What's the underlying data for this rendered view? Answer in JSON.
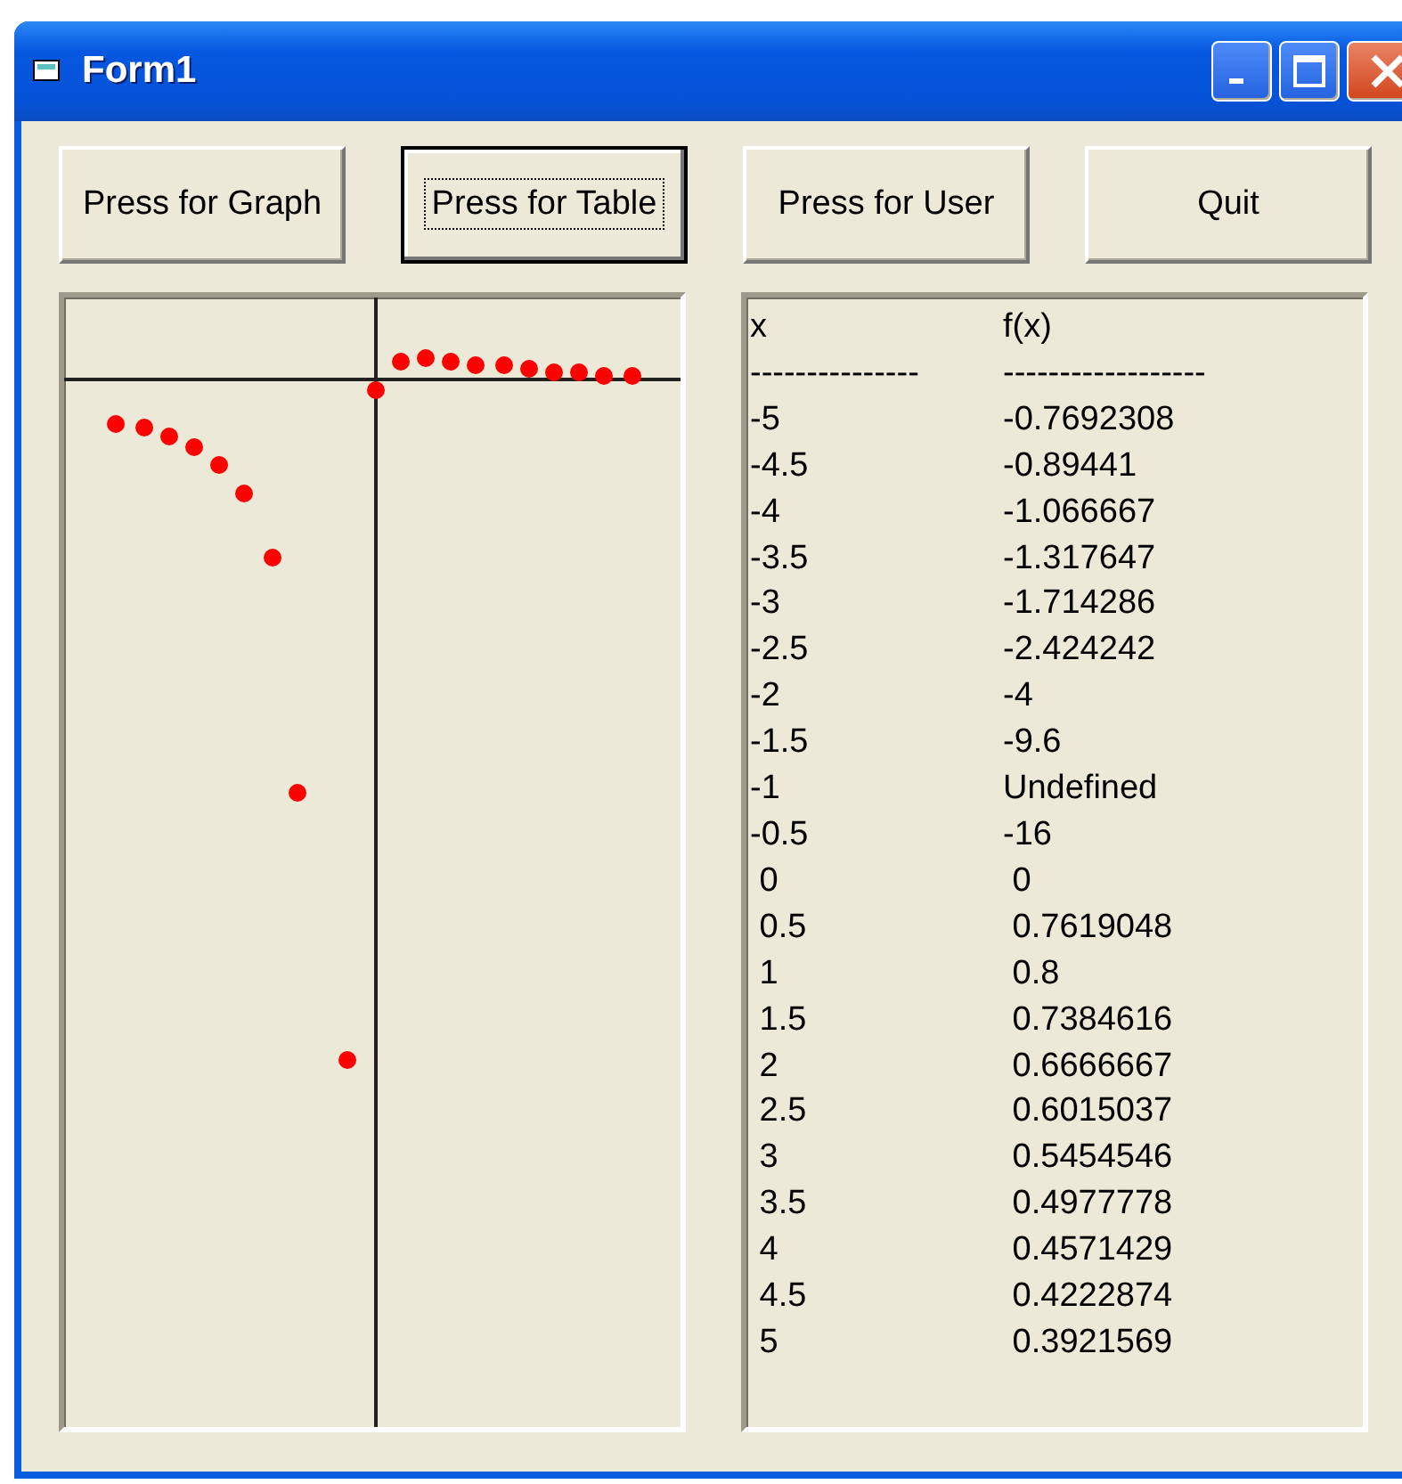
{
  "window": {
    "title": "Form1"
  },
  "buttons": [
    {
      "label": "Press for Graph",
      "focused": false
    },
    {
      "label": "Press for Table",
      "focused": true
    },
    {
      "label": "Press for User",
      "focused": false
    },
    {
      "label": "Quit",
      "focused": false
    }
  ],
  "table": {
    "columns": [
      "x",
      "f(x)"
    ],
    "separators": [
      "---------------",
      "------------------"
    ],
    "rows": [
      [
        "-5",
        "-0.7692308"
      ],
      [
        "-4.5",
        "-0.89441"
      ],
      [
        "-4",
        "-1.066667"
      ],
      [
        "-3.5",
        "-1.317647"
      ],
      [
        "-3",
        "-1.714286"
      ],
      [
        "-2.5",
        "-2.424242"
      ],
      [
        "-2",
        "-4"
      ],
      [
        "-1.5",
        "-9.6"
      ],
      [
        "-1",
        "Undefined"
      ],
      [
        "-0.5",
        "-16"
      ],
      [
        " 0",
        " 0"
      ],
      [
        " 0.5",
        " 0.7619048"
      ],
      [
        " 1",
        " 0.8"
      ],
      [
        " 1.5",
        " 0.7384616"
      ],
      [
        " 2",
        " 0.6666667"
      ],
      [
        " 2.5",
        " 0.6015037"
      ],
      [
        " 3",
        " 0.5454546"
      ],
      [
        " 3.5",
        " 0.4977778"
      ],
      [
        " 4",
        " 0.4571429"
      ],
      [
        " 4.5",
        " 0.4222874"
      ],
      [
        " 5",
        " 0.3921569"
      ]
    ]
  }
}
